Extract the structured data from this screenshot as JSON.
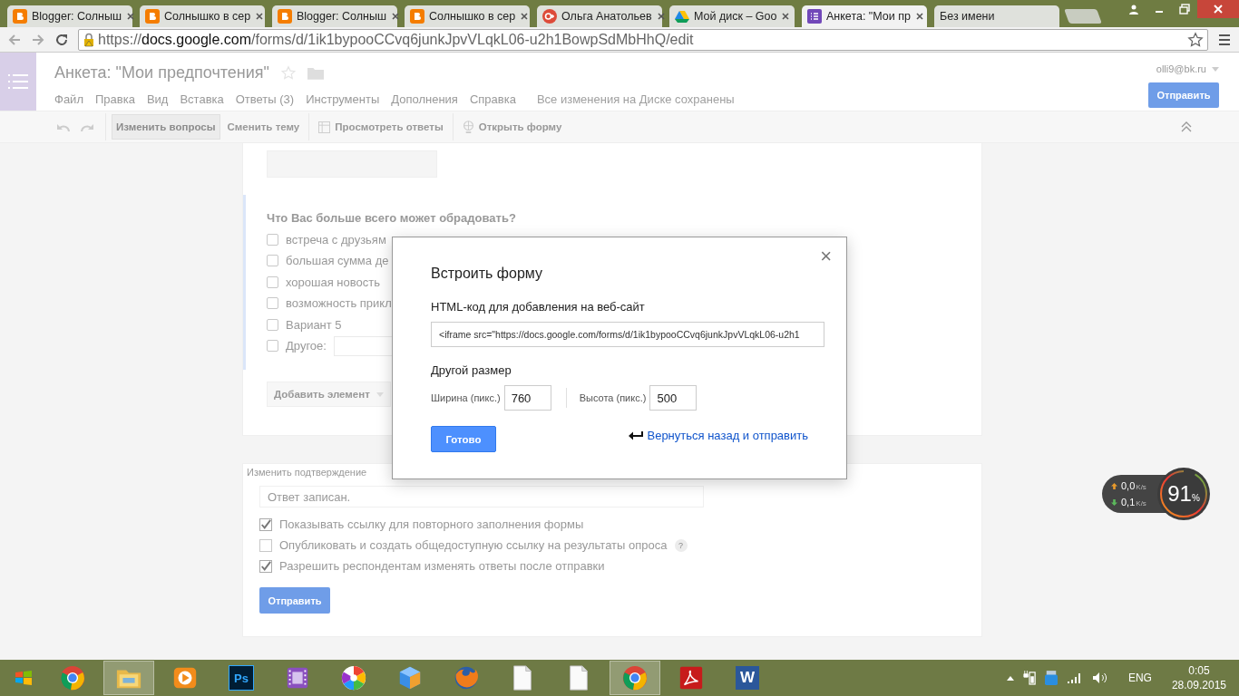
{
  "browser": {
    "tabs": [
      {
        "title": "Blogger: Солныш",
        "kind": "blogger",
        "selected": false,
        "closable": true
      },
      {
        "title": "Солнышко в сер",
        "kind": "blogger",
        "selected": false,
        "closable": true
      },
      {
        "title": "Blogger: Солныш",
        "kind": "blogger",
        "selected": false,
        "closable": true
      },
      {
        "title": "Солнышко в сер",
        "kind": "blogger",
        "selected": false,
        "closable": true
      },
      {
        "title": "Ольга Анатольев",
        "kind": "gplus",
        "selected": false,
        "closable": true
      },
      {
        "title": "Мой диск – Goo",
        "kind": "drive",
        "selected": false,
        "closable": true
      },
      {
        "title": "Анкета: \"Мои пр",
        "kind": "forms",
        "selected": true,
        "closable": true
      },
      {
        "title": "Без имени",
        "kind": "blank",
        "selected": false,
        "closable": false
      }
    ],
    "url_prefix": "https://",
    "url_host": "docs.google.com",
    "url_path": "/forms/d/1ik1bypooCCvq6junkJpvVLqkL06-u2h1BowpSdMbHhQ/edit"
  },
  "app": {
    "title": "Анкета: \"Мои предпочтения\"",
    "account": "olli9@bk.ru",
    "send_button": "Отправить",
    "menu": [
      "Файл",
      "Правка",
      "Вид",
      "Вставка",
      "Ответы (3)",
      "Инструменты",
      "Дополнения",
      "Справка"
    ],
    "save_status": "Все изменения на Диске сохранены",
    "toolbar": [
      {
        "label": "Изменить вопросы",
        "kind": "text",
        "selected": true
      },
      {
        "label": "Сменить тему",
        "kind": "text",
        "selected": false
      },
      {
        "label": "Просмотреть ответы",
        "kind": "table",
        "selected": false
      },
      {
        "label": "Открыть форму",
        "kind": "globe",
        "selected": false
      }
    ]
  },
  "form": {
    "question": "Что Вас больше всего может обрадовать?",
    "options": [
      {
        "label": "встреча с друзьям",
        "kind": "plain",
        "checked": false
      },
      {
        "label": "большая сумма де",
        "kind": "plain",
        "checked": false
      },
      {
        "label": "хорошая новость",
        "kind": "plain",
        "checked": false
      },
      {
        "label": "возможность прикл",
        "kind": "plain",
        "checked": false
      },
      {
        "label": "Вариант 5",
        "kind": "plain",
        "checked": false
      },
      {
        "label": "Другое:",
        "kind": "other",
        "checked": false
      }
    ],
    "add_button": "Добавить элемент",
    "confirmation": {
      "label": "Изменить подтверждение",
      "placeholder": "Ответ записан.",
      "settings": [
        {
          "label": "Показывать ссылку для повторного заполнения формы",
          "checked": true
        },
        {
          "label": "Опубликовать и создать общедоступную ссылку на результаты опроса",
          "checked": false,
          "help_mark": "?"
        },
        {
          "label": "Разрешить респондентам изменять ответы после отправки",
          "checked": true
        }
      ],
      "submit": "Отправить"
    }
  },
  "dialog": {
    "title": "Встроить форму",
    "close": "×",
    "code_label": "HTML-код для добавления на веб-сайт",
    "code_value": "<iframe src=\"https://docs.google.com/forms/d/1ik1bypooCCvq6junkJpvVLqkL06-u2h1",
    "size_label": "Другой размер",
    "width_label": "Ширина (пикс.)",
    "width_value": "760",
    "height_label": "Высота (пикс.)",
    "height_value": "500",
    "done_button": "Готово",
    "back_link": "Вернуться назад и отправить"
  },
  "net_widget": {
    "upload": "0,0",
    "upload_unit": "K/s",
    "download": "0,1",
    "download_unit": "K/s",
    "percent": "91",
    "percent_sign": "%",
    "level": 0.91
  },
  "taskbar": {
    "items": [
      {
        "kind": "chrome",
        "selected": false
      },
      {
        "kind": "folder",
        "selected": true
      },
      {
        "kind": "player",
        "selected": false
      },
      {
        "kind": "photoshop",
        "label": "Ps",
        "selected": false
      },
      {
        "kind": "video",
        "selected": false
      },
      {
        "kind": "picasa",
        "selected": false
      },
      {
        "kind": "box",
        "selected": false
      },
      {
        "kind": "firefox",
        "selected": false
      },
      {
        "kind": "file",
        "selected": false
      },
      {
        "kind": "file",
        "selected": false
      },
      {
        "kind": "chrome",
        "selected": true
      },
      {
        "kind": "pdf",
        "selected": false
      },
      {
        "kind": "word",
        "label": "W",
        "selected": false
      }
    ],
    "language": "ENG",
    "time": "0:05",
    "date": "28.09.2015"
  }
}
